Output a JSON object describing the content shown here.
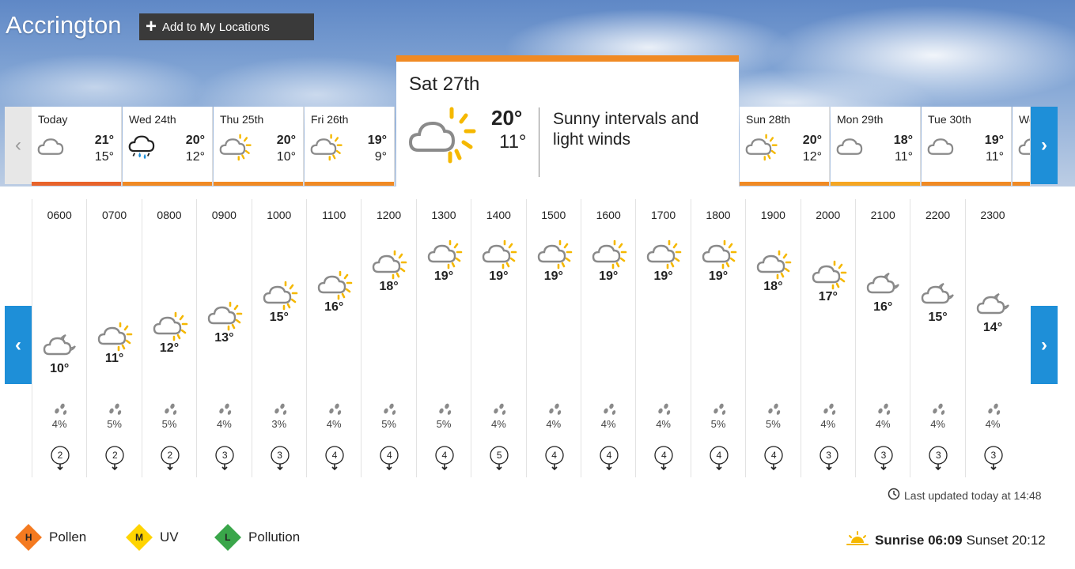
{
  "location": {
    "name": "Accrington",
    "add_button_label": "Add to My Locations"
  },
  "days": [
    {
      "label": "Today",
      "icon": "cloud-icon",
      "high": "21°",
      "low": "15°",
      "bar_color": "#e8632b"
    },
    {
      "label": "Wed 24th",
      "icon": "rain-cloud-icon",
      "high": "20°",
      "low": "12°",
      "bar_color": "#f08a24"
    },
    {
      "label": "Thu 25th",
      "icon": "sunny-intervals-icon",
      "high": "20°",
      "low": "10°",
      "bar_color": "#f08a24"
    },
    {
      "label": "Fri 26th",
      "icon": "sunny-intervals-icon",
      "high": "19°",
      "low": "9°",
      "bar_color": "#f08a24"
    },
    {
      "label": "Sun 28th",
      "icon": "sunny-intervals-icon",
      "high": "20°",
      "low": "12°",
      "bar_color": "#f08a24"
    },
    {
      "label": "Mon 29th",
      "icon": "cloud-icon",
      "high": "18°",
      "low": "11°",
      "bar_color": "#f5a623"
    },
    {
      "label": "Tue 30th",
      "icon": "cloud-icon",
      "high": "19°",
      "low": "11°",
      "bar_color": "#f08a24"
    },
    {
      "label": "We",
      "icon": "cloud-icon",
      "high": "",
      "low": "",
      "bar_color": "#f08a24"
    }
  ],
  "selected_day": {
    "label": "Sat 27th",
    "high": "20°",
    "low": "11°",
    "summary": "Sunny intervals and light winds",
    "icon": "sunny-intervals-icon"
  },
  "hourly": [
    {
      "time": "0600",
      "icon": "night-cloud-icon",
      "temp": "10°",
      "temp_value": 10,
      "rain": "4%",
      "wind": "2"
    },
    {
      "time": "0700",
      "icon": "sunny-intervals-icon",
      "temp": "11°",
      "temp_value": 11,
      "rain": "5%",
      "wind": "2"
    },
    {
      "time": "0800",
      "icon": "sunny-intervals-icon",
      "temp": "12°",
      "temp_value": 12,
      "rain": "5%",
      "wind": "2"
    },
    {
      "time": "0900",
      "icon": "sunny-intervals-icon",
      "temp": "13°",
      "temp_value": 13,
      "rain": "4%",
      "wind": "3"
    },
    {
      "time": "1000",
      "icon": "sunny-intervals-icon",
      "temp": "15°",
      "temp_value": 15,
      "rain": "3%",
      "wind": "3"
    },
    {
      "time": "1100",
      "icon": "sunny-intervals-icon",
      "temp": "16°",
      "temp_value": 16,
      "rain": "4%",
      "wind": "4"
    },
    {
      "time": "1200",
      "icon": "sunny-intervals-icon",
      "temp": "18°",
      "temp_value": 18,
      "rain": "5%",
      "wind": "4"
    },
    {
      "time": "1300",
      "icon": "sunny-intervals-icon",
      "temp": "19°",
      "temp_value": 19,
      "rain": "5%",
      "wind": "4"
    },
    {
      "time": "1400",
      "icon": "sunny-intervals-icon",
      "temp": "19°",
      "temp_value": 19,
      "rain": "4%",
      "wind": "5"
    },
    {
      "time": "1500",
      "icon": "sunny-intervals-icon",
      "temp": "19°",
      "temp_value": 19,
      "rain": "4%",
      "wind": "4"
    },
    {
      "time": "1600",
      "icon": "sunny-intervals-icon",
      "temp": "19°",
      "temp_value": 19,
      "rain": "4%",
      "wind": "4"
    },
    {
      "time": "1700",
      "icon": "sunny-intervals-icon",
      "temp": "19°",
      "temp_value": 19,
      "rain": "4%",
      "wind": "4"
    },
    {
      "time": "1800",
      "icon": "sunny-intervals-icon",
      "temp": "19°",
      "temp_value": 19,
      "rain": "5%",
      "wind": "4"
    },
    {
      "time": "1900",
      "icon": "sunny-intervals-icon",
      "temp": "18°",
      "temp_value": 18,
      "rain": "5%",
      "wind": "4"
    },
    {
      "time": "2000",
      "icon": "sunny-intervals-icon",
      "temp": "17°",
      "temp_value": 17,
      "rain": "4%",
      "wind": "3"
    },
    {
      "time": "2100",
      "icon": "night-cloud-icon",
      "temp": "16°",
      "temp_value": 16,
      "rain": "4%",
      "wind": "3"
    },
    {
      "time": "2200",
      "icon": "night-cloud-icon",
      "temp": "15°",
      "temp_value": 15,
      "rain": "4%",
      "wind": "3"
    },
    {
      "time": "2300",
      "icon": "night-cloud-icon",
      "temp": "14°",
      "temp_value": 14,
      "rain": "4%",
      "wind": "3"
    }
  ],
  "last_updated": "Last updated today at 14:48",
  "indicators": [
    {
      "letter": "H",
      "label": "Pollen",
      "color": "#f47a20"
    },
    {
      "letter": "M",
      "label": "UV",
      "color": "#ffd400"
    },
    {
      "letter": "L",
      "label": "Pollution",
      "color": "#3aa64a"
    }
  ],
  "sun": {
    "sunrise_label": "Sunrise 06:09",
    "sunset_label": "Sunset 20:12"
  },
  "nav": {
    "prev": "‹",
    "next": "›"
  }
}
